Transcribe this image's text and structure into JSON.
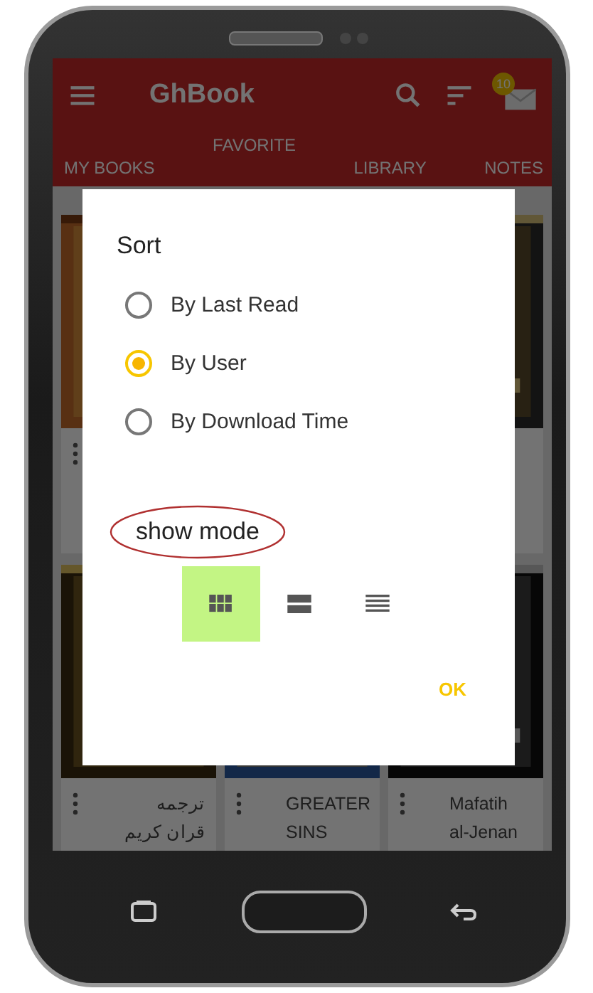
{
  "app_bar": {
    "title": "GhBook",
    "badge": "10"
  },
  "tabs": [
    {
      "label": "MY BOOKS"
    },
    {
      "label": "FAVORITE"
    },
    {
      "label": "LIBRARY"
    },
    {
      "label": "NOTES"
    }
  ],
  "books": [
    {
      "kind": "picture"
    },
    {
      "kind": "picture"
    },
    {
      "kind": "picture",
      "title": "ترجمه قران كريم"
    },
    {
      "kind": "picture",
      "title": "GREATER SINS"
    },
    {
      "kind": "picture",
      "title": "Mafatih al-Jenan"
    }
  ],
  "dialog": {
    "title": "Sort",
    "options": [
      {
        "label": "By Last Read",
        "selected": false
      },
      {
        "label": "By User",
        "selected": true
      },
      {
        "label": "By Download Time",
        "selected": false
      }
    ],
    "show_mode_label": "show mode",
    "modes": [
      {
        "kind": "grid",
        "selected": true
      },
      {
        "kind": "rows",
        "selected": false
      },
      {
        "kind": "list",
        "selected": false
      }
    ],
    "ok": "OK"
  }
}
